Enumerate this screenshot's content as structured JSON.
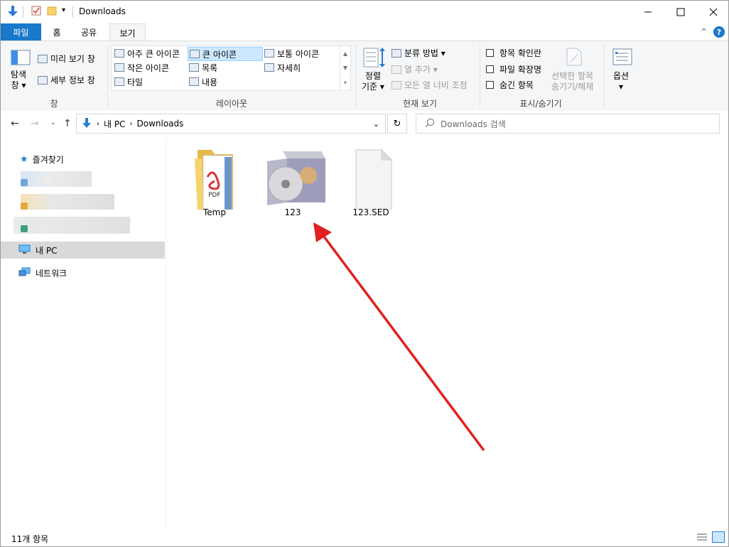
{
  "window": {
    "title": "Downloads"
  },
  "tabs": [
    {
      "label": "파일"
    },
    {
      "label": "홈"
    },
    {
      "label": "공유"
    },
    {
      "label": "보기"
    }
  ],
  "ribbon": {
    "pane": {
      "nav_pane": "탐색\n창 ▾",
      "preview": "미리 보기 창",
      "details": "세부 정보 창",
      "label": "창"
    },
    "layout": {
      "label": "레이아웃",
      "items": [
        "아주 큰 아이콘",
        "큰 아이콘",
        "보통 아이콘",
        "작은 아이콘",
        "목록",
        "자세히",
        "타일",
        "내용"
      ],
      "selected": "큰 아이콘"
    },
    "current_view": {
      "label": "현재 보기",
      "sort": "정렬\n기준 ▾",
      "group_by": "분류 방법 ▾",
      "add_columns": "열 추가 ▾",
      "fit_columns": "모든 열 너비 조정"
    },
    "show_hide": {
      "label": "표시/숨기기",
      "item_checkboxes": "항목 확인란",
      "file_extensions": "파일 확장명",
      "hidden_items": "숨긴 항목",
      "hide_selected": "선택한 항목\n숨기기/해제"
    },
    "options": {
      "label": "옵션\n▾"
    }
  },
  "address": {
    "path": [
      "내 PC",
      "Downloads"
    ],
    "search_placeholder": "Downloads 검색"
  },
  "nav": {
    "quick_access": "즐겨찾기",
    "this_pc": "내 PC",
    "network": "네트워크"
  },
  "files": [
    {
      "name": "Temp",
      "icon": "folder-pdf-icon"
    },
    {
      "name": "123",
      "icon": "software-box-cd-icon"
    },
    {
      "name": "123.SED",
      "icon": "blank-file-icon"
    }
  ],
  "status": {
    "count": "11개 항목"
  },
  "colors": {
    "accent": "#1979ca",
    "arrow": "#e02020",
    "selected": "#cce8ff"
  }
}
